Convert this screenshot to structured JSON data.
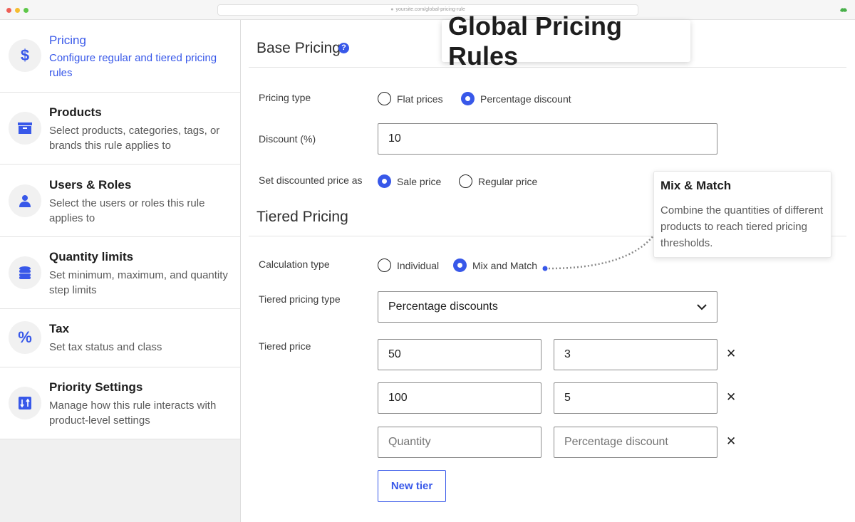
{
  "browser": {
    "url": "yoursite.com/global-pricing-rule"
  },
  "sidebar": {
    "items": [
      {
        "icon": "dollar-icon",
        "title": "Pricing",
        "desc": "Configure regular and tiered pricing rules",
        "active": true
      },
      {
        "icon": "archive-box-icon",
        "title": "Products",
        "desc": "Select products, categories, tags, or brands this rule applies to"
      },
      {
        "icon": "user-icon",
        "title": "Users & Roles",
        "desc": "Select the users or roles this rule applies to"
      },
      {
        "icon": "database-stack-icon",
        "title": "Quantity limits",
        "desc": "Set minimum, maximum, and quantity step limits"
      },
      {
        "icon": "percent-icon",
        "title": "Tax",
        "desc": "Set tax status and class"
      },
      {
        "icon": "sort-arrows-icon",
        "title": "Priority Settings",
        "desc": "Manage how this rule interacts with product-level settings"
      }
    ]
  },
  "banner": {
    "title": "Global Pricing Rules"
  },
  "base_pricing": {
    "title": "Base Pricing",
    "help": "?",
    "pricing_type": {
      "label": "Pricing type",
      "options": [
        "Flat prices",
        "Percentage discount"
      ],
      "selected": "Percentage discount"
    },
    "discount": {
      "label": "Discount (%)",
      "value": "10"
    },
    "discounted_price_as": {
      "label": "Set discounted price as",
      "options": [
        "Sale price",
        "Regular price"
      ],
      "selected": "Sale price"
    }
  },
  "tiered_pricing": {
    "title": "Tiered Pricing",
    "calculation_type": {
      "label": "Calculation type",
      "options": [
        "Individual",
        "Mix and Match"
      ],
      "selected": "Mix and Match"
    },
    "tiered_pricing_type": {
      "label": "Tiered pricing type",
      "value": "Percentage discounts"
    },
    "tiered_price": {
      "label": "Tiered price",
      "rows": [
        {
          "quantity": "50",
          "discount": "3"
        },
        {
          "quantity": "100",
          "discount": "5"
        },
        {
          "quantity": "",
          "discount": ""
        }
      ],
      "quantity_placeholder": "Quantity",
      "discount_placeholder": "Percentage discount",
      "remove_symbol": "✕"
    },
    "new_tier_label": "New tier"
  },
  "tooltip": {
    "title": "Mix & Match",
    "body": "Combine the quantities of different products to reach tiered pricing thresholds."
  },
  "colors": {
    "accent": "#3858e9",
    "text": "#1e1e1e",
    "muted": "#5a5a5a"
  }
}
